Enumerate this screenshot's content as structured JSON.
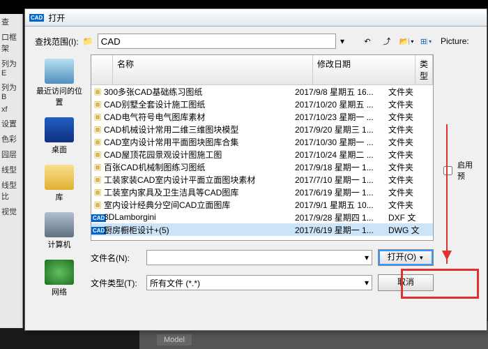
{
  "title": "打开",
  "appIcon": "CAD",
  "left_panel": [
    "查",
    "口框架",
    "列为E",
    "列为B",
    "xf",
    "设置",
    "色彩",
    "园层",
    "线型",
    "线型比",
    "视觉"
  ],
  "lookin": {
    "label": "查找范围(I):",
    "value": "CAD"
  },
  "tools": [
    "back",
    "up",
    "new",
    "views",
    "extras"
  ],
  "places": [
    {
      "label": "最近访问的位置",
      "cls": "i-recent"
    },
    {
      "label": "桌面",
      "cls": "i-desktop"
    },
    {
      "label": "库",
      "cls": "i-lib"
    },
    {
      "label": "计算机",
      "cls": "i-computer"
    },
    {
      "label": "网络",
      "cls": "i-net"
    }
  ],
  "columns": {
    "name": "名称",
    "date": "修改日期",
    "type": "类型"
  },
  "files": [
    {
      "icon": "fold",
      "name": "300多张CAD基础练习图纸",
      "date": "2017/9/8 星期五 16...",
      "type": "文件夹"
    },
    {
      "icon": "fold",
      "name": "CAD别墅全套设计施工图纸",
      "date": "2017/10/20 星期五 ...",
      "type": "文件夹"
    },
    {
      "icon": "fold",
      "name": "CAD电气符号电气图库素材",
      "date": "2017/10/23 星期一 ...",
      "type": "文件夹"
    },
    {
      "icon": "fold",
      "name": "CAD机械设计常用二维三维图块模型",
      "date": "2017/9/20 星期三 1...",
      "type": "文件夹"
    },
    {
      "icon": "fold",
      "name": "CAD室内设计常用平面图块图库合集",
      "date": "2017/10/30 星期一 ...",
      "type": "文件夹"
    },
    {
      "icon": "fold",
      "name": "CAD屋顶花园景观设计图施工图",
      "date": "2017/10/24 星期二 ...",
      "type": "文件夹"
    },
    {
      "icon": "fold",
      "name": "百张CAD机械制图练习图纸",
      "date": "2017/9/18 星期一 1...",
      "type": "文件夹"
    },
    {
      "icon": "fold",
      "name": "工装家装CAD室内设计平面立面图块素材",
      "date": "2017/7/10 星期一 1...",
      "type": "文件夹"
    },
    {
      "icon": "fold",
      "name": "工装室内家具及卫生洁具等CAD图库",
      "date": "2017/6/19 星期一 1...",
      "type": "文件夹"
    },
    {
      "icon": "fold",
      "name": "室内设计经典分空间CAD立面图库",
      "date": "2017/9/1 星期五 10...",
      "type": "文件夹"
    },
    {
      "icon": "cad",
      "name": "3DLamborgini",
      "date": "2017/9/28 星期四 1...",
      "type": "DXF 文"
    },
    {
      "icon": "cad",
      "name": "厨房橱柜设计+(5)",
      "date": "2017/6/19 星期一 1...",
      "type": "DWG 文",
      "sel": true
    }
  ],
  "filename": {
    "label": "文件名(N):",
    "value": ""
  },
  "filetype": {
    "label": "文件类型(T):",
    "value": "所有文件 (*.*)"
  },
  "buttons": {
    "open": "打开(O)",
    "cancel": "取消"
  },
  "picture_label": "Picture:",
  "enable_checkbox": "启用预",
  "model_tab": "Model"
}
